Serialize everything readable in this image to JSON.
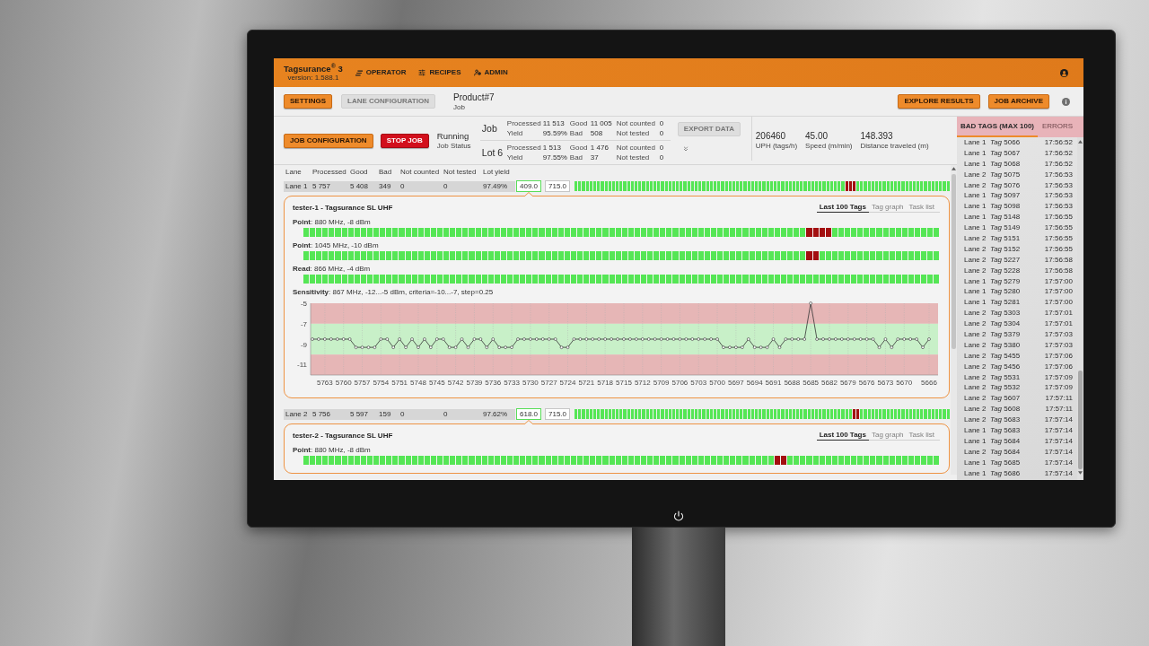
{
  "header": {
    "logo": "Tagsurance$^{®}$ 3",
    "version": "version: 1.588.1",
    "nav": [
      {
        "label": "OPERATOR"
      },
      {
        "label": "RECIPES"
      },
      {
        "label": "ADMIN"
      }
    ]
  },
  "toolbar": {
    "left_buttons": [
      {
        "label": "SETTINGS",
        "kind": "primary",
        "disabled": false
      },
      {
        "label": "LANE CONFIGURATION",
        "kind": "primary",
        "disabled": true
      }
    ],
    "product": {
      "name": "Product#7",
      "caption": "Job"
    },
    "right_buttons": [
      {
        "label": "EXPLORE RESULTS",
        "kind": "primary",
        "disabled": false
      },
      {
        "label": "JOB ARCHIVE",
        "kind": "primary",
        "disabled": false
      }
    ]
  },
  "job_bar": {
    "buttons": [
      {
        "label": "JOB CONFIGURATION",
        "kind": "primary",
        "disabled": false
      },
      {
        "label": "STOP JOB",
        "kind": "danger",
        "disabled": false
      }
    ],
    "status": {
      "value": "Running",
      "caption": "Job Status"
    },
    "summaries": [
      {
        "title": "Job",
        "fields": [
          {
            "label": "Processed",
            "value": "11 513"
          },
          {
            "label": "Good",
            "value": "11 005"
          },
          {
            "label": "Not counted",
            "value": "0"
          },
          {
            "label": "Yield",
            "value": "95.59%"
          },
          {
            "label": "Bad",
            "value": "508"
          },
          {
            "label": "Not tested",
            "value": "0"
          }
        ]
      },
      {
        "title": "Lot 6",
        "fields": [
          {
            "label": "Processed",
            "value": "1 513"
          },
          {
            "label": "Good",
            "value": "1 476"
          },
          {
            "label": "Not counted",
            "value": "0"
          },
          {
            "label": "Yield",
            "value": "97.55%"
          },
          {
            "label": "Bad",
            "value": "37"
          },
          {
            "label": "Not tested",
            "value": "0"
          }
        ]
      }
    ],
    "export_button": {
      "label": "EXPORT DATA",
      "kind": "primary",
      "disabled": true
    },
    "stats": [
      {
        "value": "206460",
        "label": "UPH (tags/h)"
      },
      {
        "value": "45.00",
        "label": "Speed (m/min)"
      },
      {
        "value": "148.393",
        "label": "Distance traveled (m)"
      }
    ]
  },
  "lane_table": {
    "columns": [
      "Lane",
      "Processed",
      "Good",
      "Bad",
      "Not counted",
      "Not tested",
      "Lot yield"
    ],
    "lanes": [
      {
        "cells": [
          "Lane 1",
          "5 757",
          "5 408",
          "349",
          "0",
          "0",
          "97.49%"
        ],
        "readings": [
          {
            "text": "409.0",
            "highlighted": true
          },
          {
            "text": "715.0",
            "highlighted": false
          }
        ],
        "expanded": true,
        "tags_failed": [
          false,
          false,
          false,
          false,
          false,
          false,
          false,
          false,
          false,
          false,
          false,
          false,
          false,
          false,
          false,
          false,
          false,
          false,
          false,
          false,
          false,
          false,
          false,
          false,
          false,
          false,
          false,
          false,
          false,
          false,
          false,
          false,
          false,
          false,
          false,
          false,
          false,
          false,
          false,
          false,
          false,
          false,
          false,
          false,
          false,
          false,
          false,
          false,
          false,
          false,
          false,
          false,
          false,
          false,
          false,
          false,
          false,
          false,
          false,
          false,
          false,
          false,
          false,
          false,
          false,
          false,
          false,
          false,
          false,
          false,
          false,
          false,
          true,
          true,
          true,
          false,
          false,
          false,
          false,
          false,
          false,
          false,
          false,
          false,
          false,
          false,
          false,
          false,
          false,
          false,
          false,
          false,
          false,
          false,
          false,
          false,
          false,
          false,
          false,
          false
        ],
        "tester": {
          "title": "tester-1 - Tagsurance SL UHF",
          "tabs": [
            {
              "label": "Last 100 Tags",
              "selected": true
            },
            {
              "label": "Tag graph",
              "selected": false
            },
            {
              "label": "Task list",
              "selected": false
            }
          ],
          "measurements": [
            {
              "label": "**Point**: 880 MHz, -8 dBm",
              "tags_failed": [
                false,
                false,
                false,
                false,
                false,
                false,
                false,
                false,
                false,
                false,
                false,
                false,
                false,
                false,
                false,
                false,
                false,
                false,
                false,
                false,
                false,
                false,
                false,
                false,
                false,
                false,
                false,
                false,
                false,
                false,
                false,
                false,
                false,
                false,
                false,
                false,
                false,
                false,
                false,
                false,
                false,
                false,
                false,
                false,
                false,
                false,
                false,
                false,
                false,
                false,
                false,
                false,
                false,
                false,
                false,
                false,
                false,
                false,
                false,
                false,
                false,
                false,
                false,
                false,
                false,
                false,
                false,
                false,
                false,
                false,
                false,
                false,
                false,
                false,
                false,
                false,
                false,
                false,
                false,
                true,
                true,
                true,
                true,
                false,
                false,
                false,
                false,
                false,
                false,
                false,
                false,
                false,
                false,
                false,
                false,
                false,
                false,
                false,
                false,
                false
              ]
            },
            {
              "label": "**Point**: 1045 MHz, -10 dBm",
              "tags_failed": [
                false,
                false,
                false,
                false,
                false,
                false,
                false,
                false,
                false,
                false,
                false,
                false,
                false,
                false,
                false,
                false,
                false,
                false,
                false,
                false,
                false,
                false,
                false,
                false,
                false,
                false,
                false,
                false,
                false,
                false,
                false,
                false,
                false,
                false,
                false,
                false,
                false,
                false,
                false,
                false,
                false,
                false,
                false,
                false,
                false,
                false,
                false,
                false,
                false,
                false,
                false,
                false,
                false,
                false,
                false,
                false,
                false,
                false,
                false,
                false,
                false,
                false,
                false,
                false,
                false,
                false,
                false,
                false,
                false,
                false,
                false,
                false,
                false,
                false,
                false,
                false,
                false,
                false,
                false,
                true,
                true,
                false,
                false,
                false,
                false,
                false,
                false,
                false,
                false,
                false,
                false,
                false,
                false,
                false,
                false,
                false,
                false,
                false,
                false,
                false
              ]
            },
            {
              "label": "**Read**: 866 MHz, -4 dBm",
              "tags_failed": [
                false,
                false,
                false,
                false,
                false,
                false,
                false,
                false,
                false,
                false,
                false,
                false,
                false,
                false,
                false,
                false,
                false,
                false,
                false,
                false,
                false,
                false,
                false,
                false,
                false,
                false,
                false,
                false,
                false,
                false,
                false,
                false,
                false,
                false,
                false,
                false,
                false,
                false,
                false,
                false,
                false,
                false,
                false,
                false,
                false,
                false,
                false,
                false,
                false,
                false,
                false,
                false,
                false,
                false,
                false,
                false,
                false,
                false,
                false,
                false,
                false,
                false,
                false,
                false,
                false,
                false,
                false,
                false,
                false,
                false,
                false,
                false,
                false,
                false,
                false,
                false,
                false,
                false,
                false,
                false,
                false,
                false,
                false,
                false,
                false,
                false,
                false,
                false,
                false,
                false,
                false,
                false,
                false,
                false,
                false,
                false,
                false,
                false,
                false,
                false
              ]
            }
          ],
          "sensitivity": {
            "chart_data": {
              "type": "line",
              "title": "**Sensitivity**: 867 MHz, -12...-5 dBm, criteria=-10...-7, step=0.25",
              "x": [
                5765,
                5764,
                5763,
                5762,
                5761,
                5760,
                5759,
                5758,
                5757,
                5756,
                5755,
                5754,
                5753,
                5752,
                5751,
                5750,
                5749,
                5748,
                5747,
                5746,
                5745,
                5744,
                5743,
                5742,
                5741,
                5740,
                5739,
                5738,
                5737,
                5736,
                5735,
                5734,
                5733,
                5732,
                5731,
                5730,
                5729,
                5728,
                5727,
                5726,
                5725,
                5724,
                5723,
                5722,
                5721,
                5720,
                5719,
                5718,
                5717,
                5716,
                5715,
                5714,
                5713,
                5712,
                5711,
                5710,
                5709,
                5708,
                5707,
                5706,
                5705,
                5704,
                5703,
                5702,
                5701,
                5700,
                5699,
                5698,
                5697,
                5696,
                5695,
                5694,
                5693,
                5692,
                5691,
                5690,
                5689,
                5688,
                5687,
                5686,
                5685,
                5684,
                5683,
                5682,
                5681,
                5680,
                5679,
                5678,
                5677,
                5676,
                5675,
                5674,
                5673,
                5672,
                5671,
                5670,
                5669,
                5668,
                5667,
                5666
              ],
              "series": [
                {
                  "color": "#333333",
                  "marker": "circle",
                  "values": [
                    -8.5,
                    -8.5,
                    -8.5,
                    -8.5,
                    -8.5,
                    -8.5,
                    -8.5,
                    -9.3,
                    -9.3,
                    -9.3,
                    -9.3,
                    -8.5,
                    -8.5,
                    -9.3,
                    -8.5,
                    -9.3,
                    -8.5,
                    -9.3,
                    -8.5,
                    -9.3,
                    -8.5,
                    -8.5,
                    -9.3,
                    -9.3,
                    -8.5,
                    -9.3,
                    -8.5,
                    -8.5,
                    -9.3,
                    -8.5,
                    -9.3,
                    -9.3,
                    -9.3,
                    -8.5,
                    -8.5,
                    -8.5,
                    -8.5,
                    -8.5,
                    -8.5,
                    -8.5,
                    -9.3,
                    -9.3,
                    -8.5,
                    -8.5,
                    -8.5,
                    -8.5,
                    -8.5,
                    -8.5,
                    -8.5,
                    -8.5,
                    -8.5,
                    -8.5,
                    -8.5,
                    -8.5,
                    -8.5,
                    -8.5,
                    -8.5,
                    -8.5,
                    -8.5,
                    -8.5,
                    -8.5,
                    -8.5,
                    -8.5,
                    -8.5,
                    -8.5,
                    -8.5,
                    -9.3,
                    -9.3,
                    -9.3,
                    -9.3,
                    -8.5,
                    -9.3,
                    -9.3,
                    -9.3,
                    -8.5,
                    -9.3,
                    -8.5,
                    -8.5,
                    -8.5,
                    -8.5,
                    -5,
                    -8.5,
                    -8.5,
                    -8.5,
                    -8.5,
                    -8.5,
                    -8.5,
                    -8.5,
                    -8.5,
                    -8.5,
                    -8.5,
                    -9.3,
                    -8.5,
                    -9.3,
                    -8.5,
                    -8.5,
                    -8.5,
                    -8.5,
                    -9.3,
                    -8.5
                  ]
                }
              ],
              "xlim": [
                5765,
                5666
              ],
              "ylim": [
                -12,
                -5
              ],
              "xticks": [
                5763,
                5760,
                5757,
                5754,
                5751,
                5748,
                5745,
                5742,
                5739,
                5736,
                5733,
                5730,
                5727,
                5724,
                5721,
                5718,
                5715,
                5712,
                5709,
                5706,
                5703,
                5700,
                5697,
                5694,
                5691,
                5688,
                5685,
                5682,
                5679,
                5676,
                5673,
                5670,
                5666
              ],
              "yticks": [
                -5,
                -7,
                -9,
                -11
              ],
              "grid": true,
              "bands": [
                {
                  "axis": "y",
                  "from": -7,
                  "to": -5,
                  "color": "#e6b6b6"
                },
                {
                  "axis": "y",
                  "from": -10,
                  "to": -7,
                  "color": "#c8f0c8"
                },
                {
                  "axis": "y",
                  "from": -12,
                  "to": -10,
                  "color": "#e6b6b6"
                }
              ]
            }
          }
        }
      },
      {
        "cells": [
          "Lane 2",
          "5 756",
          "5 597",
          "159",
          "0",
          "0",
          "97.62%"
        ],
        "readings": [
          {
            "text": "618.0",
            "highlighted": true
          },
          {
            "text": "715.0",
            "highlighted": false
          }
        ],
        "expanded": true,
        "tags_failed": [
          false,
          false,
          false,
          false,
          false,
          false,
          false,
          false,
          false,
          false,
          false,
          false,
          false,
          false,
          false,
          false,
          false,
          false,
          false,
          false,
          false,
          false,
          false,
          false,
          false,
          false,
          false,
          false,
          false,
          false,
          false,
          false,
          false,
          false,
          false,
          false,
          false,
          false,
          false,
          false,
          false,
          false,
          false,
          false,
          false,
          false,
          false,
          false,
          false,
          false,
          false,
          false,
          false,
          false,
          false,
          false,
          false,
          false,
          false,
          false,
          false,
          false,
          false,
          false,
          false,
          false,
          false,
          false,
          false,
          false,
          false,
          false,
          false,
          false,
          true,
          true,
          false,
          false,
          false,
          false,
          false,
          false,
          false,
          false,
          false,
          false,
          false,
          false,
          false,
          false,
          false,
          false,
          false,
          false,
          false,
          false,
          false,
          false,
          false,
          false
        ],
        "tester": {
          "title": "tester-2 - Tagsurance SL UHF",
          "tabs": [
            {
              "label": "Last 100 Tags",
              "selected": true
            },
            {
              "label": "Tag graph",
              "selected": false
            },
            {
              "label": "Task list",
              "selected": false
            }
          ],
          "measurements": [
            {
              "label": "**Point**: 880 MHz, -8 dBm",
              "tags_failed": [
                false,
                false,
                false,
                false,
                false,
                false,
                false,
                false,
                false,
                false,
                false,
                false,
                false,
                false,
                false,
                false,
                false,
                false,
                false,
                false,
                false,
                false,
                false,
                false,
                false,
                false,
                false,
                false,
                false,
                false,
                false,
                false,
                false,
                false,
                false,
                false,
                false,
                false,
                false,
                false,
                false,
                false,
                false,
                false,
                false,
                false,
                false,
                false,
                false,
                false,
                false,
                false,
                false,
                false,
                false,
                false,
                false,
                false,
                false,
                false,
                false,
                false,
                false,
                false,
                false,
                false,
                false,
                false,
                false,
                false,
                false,
                false,
                false,
                false,
                true,
                true,
                false,
                false,
                false,
                false,
                false,
                false,
                false,
                false,
                false,
                false,
                false,
                false,
                false,
                false,
                false,
                false,
                false,
                false,
                false,
                false,
                false,
                false,
                false,
                false
              ]
            }
          ]
        }
      }
    ]
  },
  "bad_tags_panel": {
    "tabs": [
      {
        "label": "BAD TAGS (MAX 100)",
        "selected": true
      },
      {
        "label": "ERRORS",
        "selected": false
      }
    ],
    "rows": [
      {
        "lane": "Lane 1",
        "tag": "*Tag* 5066",
        "time": "17:56:52"
      },
      {
        "lane": "Lane 1",
        "tag": "*Tag* 5067",
        "time": "17:56:52"
      },
      {
        "lane": "Lane 1",
        "tag": "*Tag* 5068",
        "time": "17:56:52"
      },
      {
        "lane": "Lane 2",
        "tag": "*Tag* 5075",
        "time": "17:56:53"
      },
      {
        "lane": "Lane 2",
        "tag": "*Tag* 5076",
        "time": "17:56:53"
      },
      {
        "lane": "Lane 1",
        "tag": "*Tag* 5097",
        "time": "17:56:53"
      },
      {
        "lane": "Lane 1",
        "tag": "*Tag* 5098",
        "time": "17:56:53"
      },
      {
        "lane": "Lane 1",
        "tag": "*Tag* 5148",
        "time": "17:56:55"
      },
      {
        "lane": "Lane 1",
        "tag": "*Tag* 5149",
        "time": "17:56:55"
      },
      {
        "lane": "Lane 2",
        "tag": "*Tag* 5151",
        "time": "17:56:55"
      },
      {
        "lane": "Lane 2",
        "tag": "*Tag* 5152",
        "time": "17:56:55"
      },
      {
        "lane": "Lane 2",
        "tag": "*Tag* 5227",
        "time": "17:56:58"
      },
      {
        "lane": "Lane 2",
        "tag": "*Tag* 5228",
        "time": "17:56:58"
      },
      {
        "lane": "Lane 1",
        "tag": "*Tag* 5279",
        "time": "17:57:00"
      },
      {
        "lane": "Lane 1",
        "tag": "*Tag* 5280",
        "time": "17:57:00"
      },
      {
        "lane": "Lane 1",
        "tag": "*Tag* 5281",
        "time": "17:57:00"
      },
      {
        "lane": "Lane 2",
        "tag": "*Tag* 5303",
        "time": "17:57:01"
      },
      {
        "lane": "Lane 2",
        "tag": "*Tag* 5304",
        "time": "17:57:01"
      },
      {
        "lane": "Lane 2",
        "tag": "*Tag* 5379",
        "time": "17:57:03"
      },
      {
        "lane": "Lane 2",
        "tag": "*Tag* 5380",
        "time": "17:57:03"
      },
      {
        "lane": "Lane 2",
        "tag": "*Tag* 5455",
        "time": "17:57:06"
      },
      {
        "lane": "Lane 2",
        "tag": "*Tag* 5456",
        "time": "17:57:06"
      },
      {
        "lane": "Lane 2",
        "tag": "*Tag* 5531",
        "time": "17:57:09"
      },
      {
        "lane": "Lane 2",
        "tag": "*Tag* 5532",
        "time": "17:57:09"
      },
      {
        "lane": "Lane 2",
        "tag": "*Tag* 5607",
        "time": "17:57:11"
      },
      {
        "lane": "Lane 2",
        "tag": "*Tag* 5608",
        "time": "17:57:11"
      },
      {
        "lane": "Lane 2",
        "tag": "*Tag* 5683",
        "time": "17:57:14"
      },
      {
        "lane": "Lane 1",
        "tag": "*Tag* 5683",
        "time": "17:57:14"
      },
      {
        "lane": "Lane 1",
        "tag": "*Tag* 5684",
        "time": "17:57:14"
      },
      {
        "lane": "Lane 2",
        "tag": "*Tag* 5684",
        "time": "17:57:14"
      },
      {
        "lane": "Lane 1",
        "tag": "*Tag* 5685",
        "time": "17:57:14"
      },
      {
        "lane": "Lane 1",
        "tag": "*Tag* 5686",
        "time": "17:57:14"
      }
    ]
  }
}
